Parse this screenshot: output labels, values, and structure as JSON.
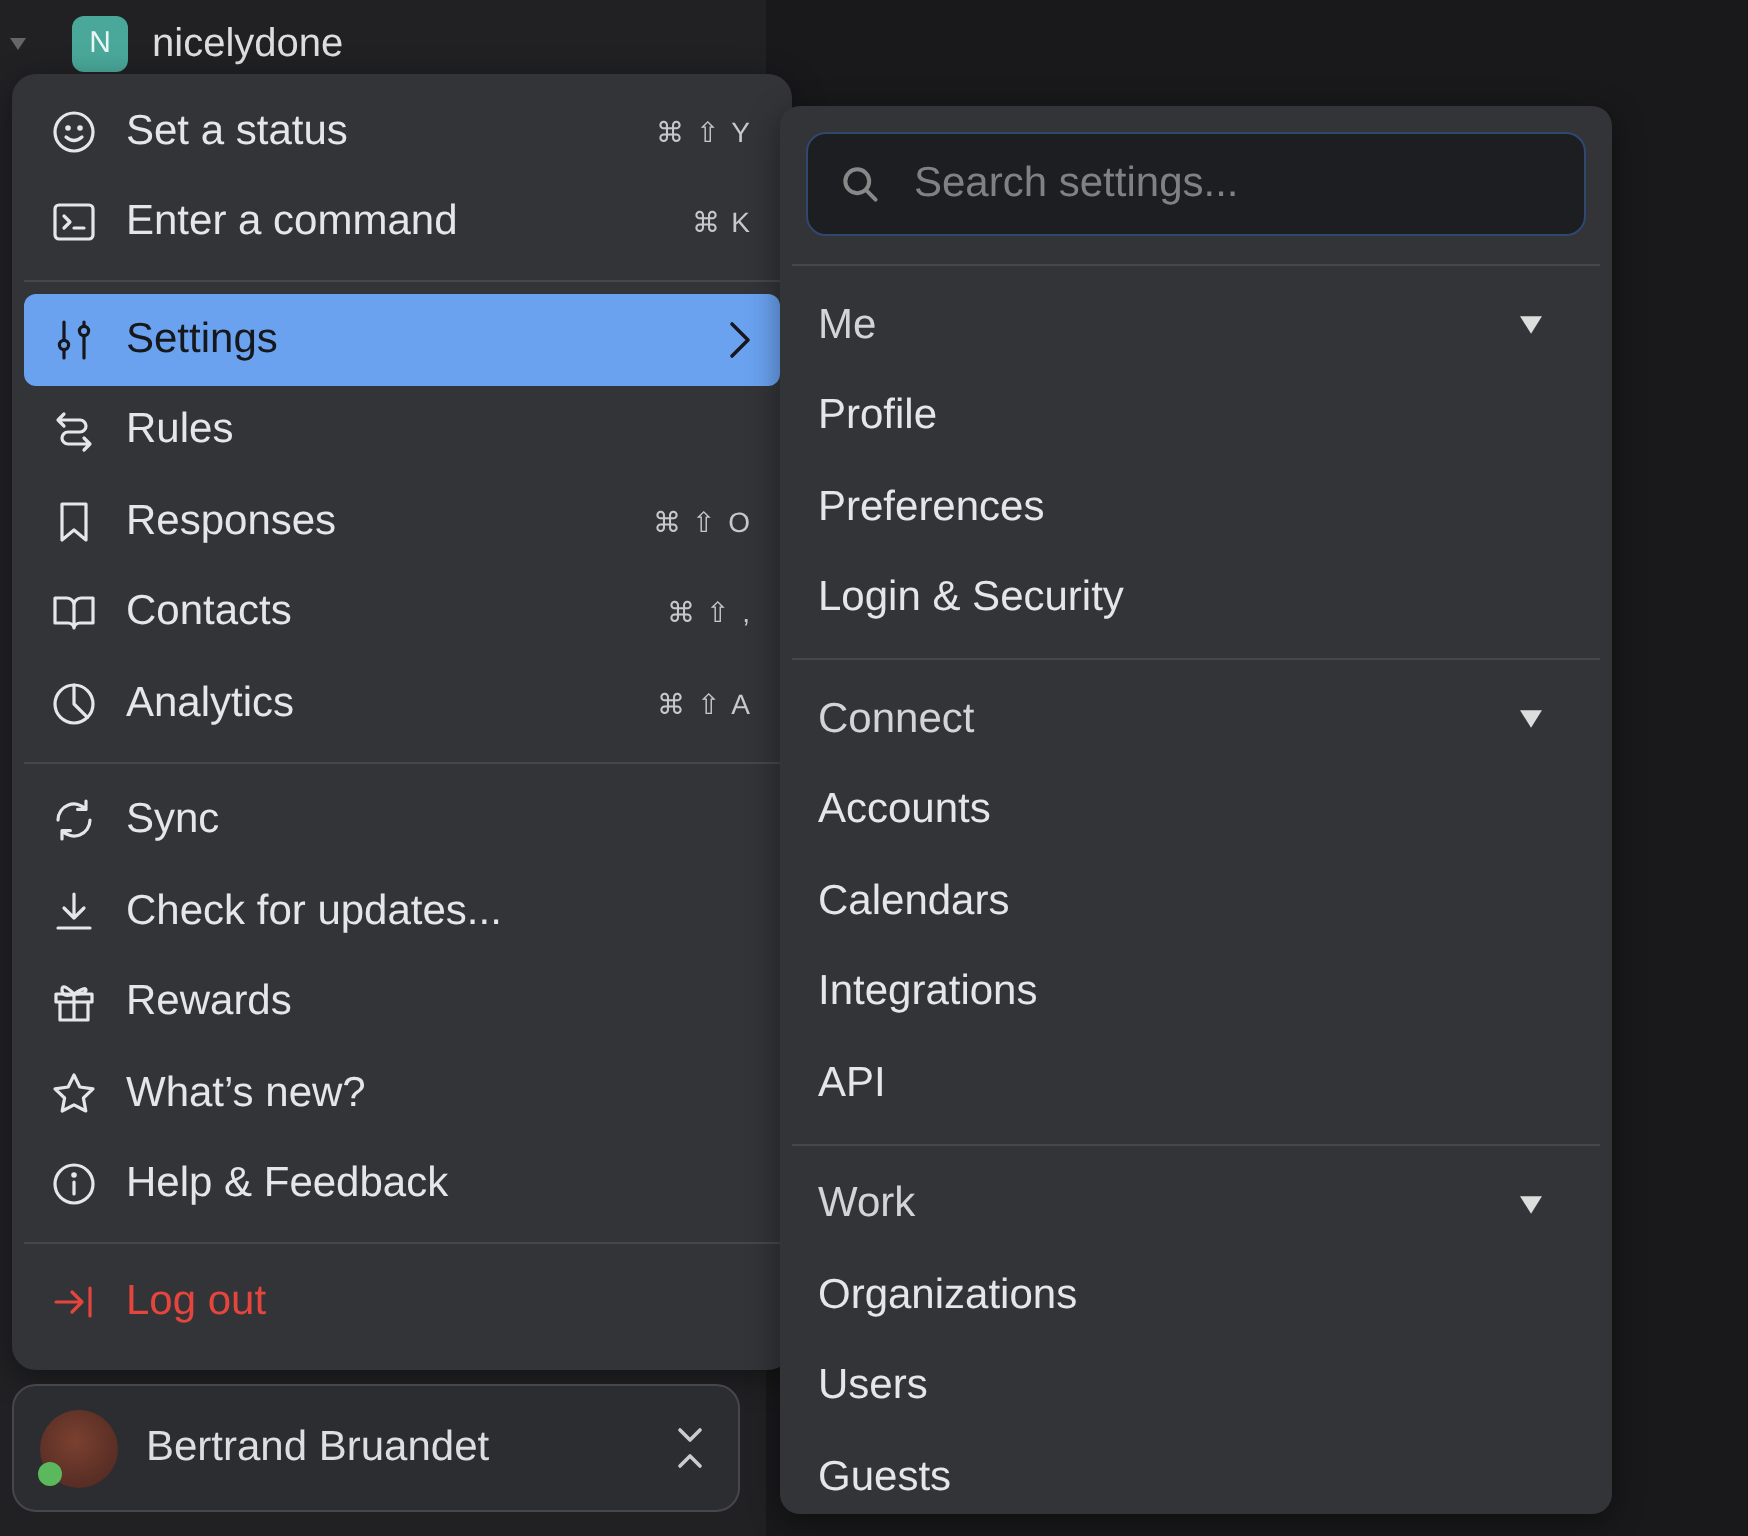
{
  "workspace": {
    "initial": "N",
    "name": "nicelydone",
    "expanded": true
  },
  "menu": {
    "groups": [
      {
        "items": [
          {
            "label": "Set a status",
            "shortcut": "⌘ ⇧ Y",
            "kind": "normal",
            "selected": false,
            "submenu": false
          },
          {
            "label": "Enter a command",
            "shortcut": "⌘ K",
            "kind": "normal",
            "selected": false,
            "submenu": false
          }
        ]
      },
      {
        "items": [
          {
            "label": "Settings",
            "kind": "normal",
            "selected": true,
            "submenu": true
          },
          {
            "label": "Rules",
            "kind": "normal",
            "selected": false,
            "submenu": false
          },
          {
            "label": "Responses",
            "shortcut": "⌘ ⇧ O",
            "kind": "normal",
            "selected": false,
            "submenu": false
          },
          {
            "label": "Contacts",
            "shortcut": "⌘ ⇧ ,",
            "kind": "normal",
            "selected": false,
            "submenu": false
          },
          {
            "label": "Analytics",
            "shortcut": "⌘ ⇧ A",
            "kind": "normal",
            "selected": false,
            "submenu": false
          }
        ]
      },
      {
        "items": [
          {
            "label": "Sync",
            "kind": "normal",
            "selected": false,
            "submenu": false
          },
          {
            "label": "Check for updates...",
            "kind": "normal",
            "selected": false,
            "submenu": false
          },
          {
            "label": "Rewards",
            "kind": "normal",
            "selected": false,
            "submenu": false
          },
          {
            "label": "What’s new?",
            "kind": "normal",
            "selected": false,
            "submenu": false
          },
          {
            "label": "Help & Feedback",
            "kind": "normal",
            "selected": false,
            "submenu": false
          }
        ]
      },
      {
        "items": [
          {
            "label": "Log out",
            "kind": "danger",
            "selected": false,
            "submenu": false
          }
        ]
      }
    ]
  },
  "settings": {
    "search": {
      "placeholder": "Search settings..."
    },
    "sections": [
      {
        "title": "Me",
        "expanded": true,
        "items": [
          "Profile",
          "Preferences",
          "Login & Security"
        ]
      },
      {
        "title": "Connect",
        "expanded": true,
        "items": [
          "Accounts",
          "Calendars",
          "Integrations",
          "API"
        ]
      },
      {
        "title": "Work",
        "expanded": true,
        "items": [
          "Organizations",
          "Users",
          "Guests"
        ]
      }
    ]
  },
  "user": {
    "name": "Bertrand Bruandet",
    "online": true
  }
}
